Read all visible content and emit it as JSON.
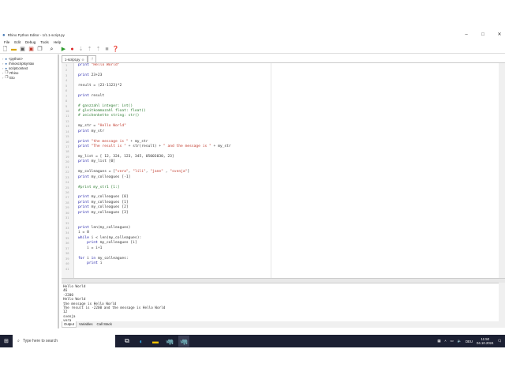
{
  "window": {
    "title": "Rhino Python Editor - 1/1.1-script.py",
    "minimize": "–",
    "maximize": "□",
    "close": "✕"
  },
  "menu": [
    "File",
    "Edit",
    "Debug",
    "Tools",
    "Help"
  ],
  "toolbar": [
    "new-file",
    "open-folder",
    "save",
    "save-as",
    "save-all",
    "find",
    "run",
    "stop",
    "step-into",
    "step-over",
    "step-out",
    "break",
    "help"
  ],
  "tree": [
    {
      "label": "<python>",
      "icon": "python-icon"
    },
    {
      "label": "rhinoscriptsyntax",
      "icon": "python-icon"
    },
    {
      "label": "scriptcontext",
      "icon": "python-icon"
    },
    {
      "label": "Rhino",
      "icon": "namespace-icon"
    },
    {
      "label": "Eto",
      "icon": "namespace-icon"
    }
  ],
  "tabs": {
    "active": "1-script.py",
    "new_tab": "new-tab"
  },
  "code": [
    "print \"Hello World\"",
    "",
    "print 23+23",
    "",
    "result = (23-1123)*2",
    "",
    "print result",
    "",
    "# ganzzahl integer: int()",
    "# gleitkommazahl float: float()",
    "# zeichenkette string: str()",
    "",
    "my_str = \"Hello World\"",
    "print my_str",
    "",
    "print \"the message is \" + my_str",
    "print \"The result is \" + str(result) + \" and the message is \" + my_str",
    "",
    "my_list = [ 12, 324, 123, 345, 05003030, 23]",
    "print my_list [0]",
    "",
    "my_colleagues = [\"vera\", \"lili\", \"jane\" , \"svenja\"]",
    "print my_colleagues [-1]",
    "",
    "#print my_str1 [1:]",
    "",
    "print my_colleagues [0]",
    "print my_colleagues [1]",
    "print my_colleagues [2]",
    "print my_colleagues [3]",
    "",
    "",
    "print len(my_colleagues)",
    "i = 0",
    "while i < len(my_colleagues):",
    "    print my_colleagues [i]",
    "    i = i+1",
    "",
    "for i in my_colleagues:",
    "    print i",
    ""
  ],
  "output": [
    "Hello World",
    "46",
    "-2200",
    "Hello World",
    "the message is Hello World",
    "The result is -2200 and the message is Hello World",
    "12",
    "svenja",
    "vera"
  ],
  "output_tabs": [
    "Output",
    "Variables",
    "Call Stack"
  ],
  "taskbar": {
    "search_placeholder": "Type here to search",
    "time": "11:50",
    "date": "04.10.2024",
    "lang": "DEU",
    "notifications": "1"
  }
}
